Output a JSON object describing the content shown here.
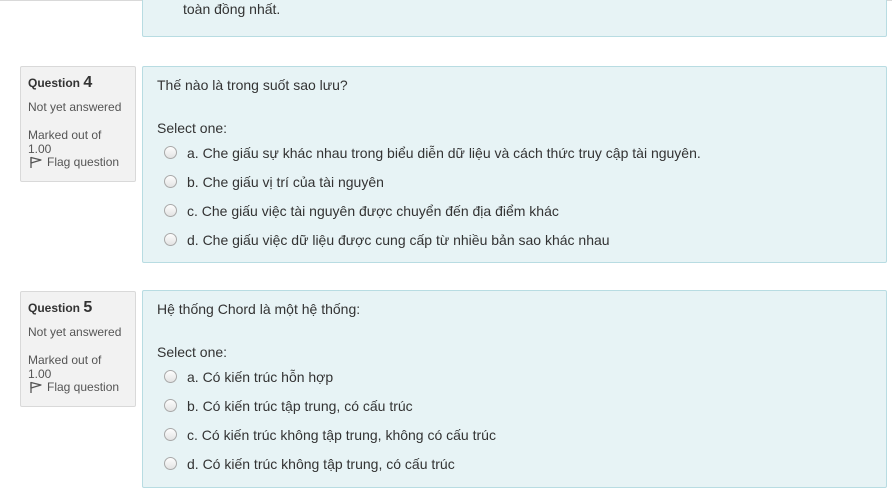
{
  "previous_question": {
    "trailing_text": "toàn đồng nhất."
  },
  "questions": [
    {
      "label": "Question",
      "number": "4",
      "state": "Not yet answered",
      "grade": "Marked out of 1.00",
      "flag_label": "Flag question",
      "text": "Thế nào là trong suốt sao lưu?",
      "prompt": "Select one:",
      "options": [
        "a. Che giấu sự khác nhau trong biểu diễn dữ liệu và cách thức truy cập tài nguyên.",
        "b. Che giấu vị trí của tài nguyên",
        "c. Che giấu việc tài nguyên được chuyển đến địa điểm khác",
        "d. Che giấu việc dữ liệu được cung cấp từ nhiều bản sao khác nhau"
      ]
    },
    {
      "label": "Question",
      "number": "5",
      "state": "Not yet answered",
      "grade": "Marked out of 1.00",
      "flag_label": "Flag question",
      "text": "Hệ thống Chord là một hệ thống:",
      "prompt": "Select one:",
      "options": [
        "a. Có kiến trúc hỗn hợp",
        "b. Có kiến trúc tập trung, có cấu trúc",
        "c. Có kiến trúc không tập trung, không có cấu trúc",
        "d. Có kiến trúc không tập trung, có cấu trúc"
      ]
    }
  ],
  "colors": {
    "content_bg": "#e7f3f5",
    "content_border": "#b8dce2",
    "info_bg": "#f2f2f2"
  },
  "icons": {
    "flag": "flag-icon",
    "radio": "radio-button"
  }
}
